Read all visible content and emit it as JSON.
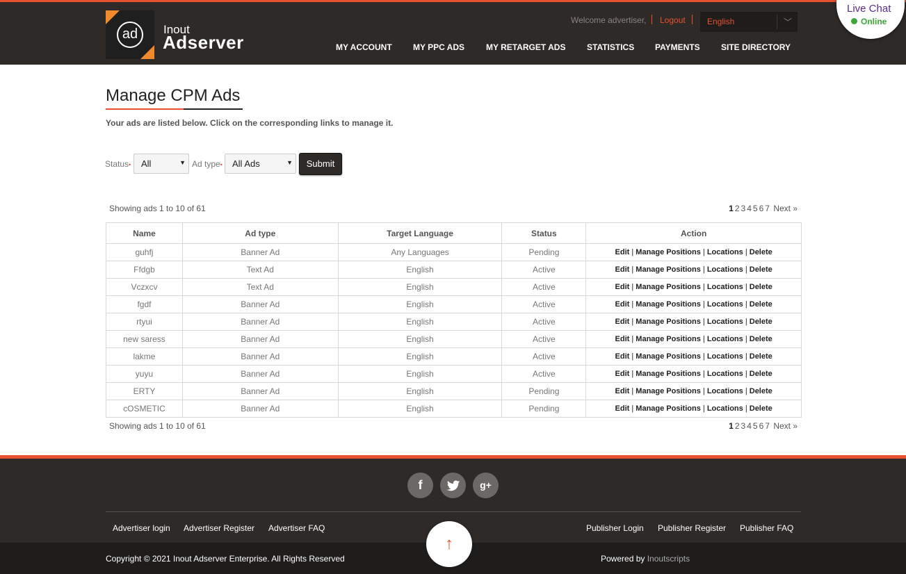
{
  "header": {
    "logo_small": "Inout",
    "logo_big": "Adserver",
    "logo_mark": "ad",
    "welcome": "Welcome advertiser,",
    "logout": "Logout",
    "language": "English",
    "nav": [
      "MY ACCOUNT",
      "MY PPC ADS",
      "MY RETARGET ADS",
      "STATISTICS",
      "PAYMENTS",
      "SITE DIRECTORY"
    ]
  },
  "livechat": {
    "title": "Live Chat",
    "status": "Online"
  },
  "main": {
    "title": "Manage CPM Ads",
    "subtitle": "Your ads are listed below. Click on the corresponding links to manage it.",
    "filters": {
      "status_label": "Status",
      "status_value": "All",
      "adtype_label": "Ad type",
      "adtype_value": "All Ads",
      "submit": "Submit"
    },
    "showing": "Showing ads 1 to 10 of 61",
    "pages": [
      "1",
      "2",
      "3",
      "4",
      "5",
      "6",
      "7"
    ],
    "next": "Next »",
    "columns": [
      "Name",
      "Ad type",
      "Target Language",
      "Status",
      "Action"
    ],
    "actions": [
      "Edit",
      "Manage Positions",
      "Locations",
      "Delete"
    ],
    "rows": [
      {
        "name": "guhfj",
        "type": "Banner Ad",
        "lang": "Any Languages",
        "status": "Pending"
      },
      {
        "name": "Ffdgb",
        "type": "Text Ad",
        "lang": "English",
        "status": "Active"
      },
      {
        "name": "Vczxcv",
        "type": "Text Ad",
        "lang": "English",
        "status": "Active"
      },
      {
        "name": "fgdf",
        "type": "Banner Ad",
        "lang": "English",
        "status": "Active"
      },
      {
        "name": "rtyui",
        "type": "Banner Ad",
        "lang": "English",
        "status": "Active"
      },
      {
        "name": "new saress",
        "type": "Banner Ad",
        "lang": "English",
        "status": "Active"
      },
      {
        "name": "lakme",
        "type": "Banner Ad",
        "lang": "English",
        "status": "Active"
      },
      {
        "name": "yuyu",
        "type": "Banner Ad",
        "lang": "English",
        "status": "Active"
      },
      {
        "name": "ERTY",
        "type": "Banner Ad",
        "lang": "English",
        "status": "Pending"
      },
      {
        "name": "cOSMETIC",
        "type": "Banner Ad",
        "lang": "English",
        "status": "Pending"
      }
    ]
  },
  "footer": {
    "social": [
      {
        "icon": "facebook-icon",
        "glyph": "f"
      },
      {
        "icon": "twitter-icon",
        "glyph": "🐦"
      },
      {
        "icon": "google-plus-icon",
        "glyph": "g+"
      }
    ],
    "left_links": [
      "Advertiser login",
      "Advertiser Register",
      "Advertiser FAQ"
    ],
    "right_links": [
      "Publisher Login",
      "Publisher Register",
      "Publisher FAQ"
    ],
    "copyright": "Copyright © 2021 Inout Adserver Enterprise. All Rights Reserved",
    "powered_by": "Powered by",
    "powered_link": "Inoutscripts",
    "up_icon": "↑"
  }
}
